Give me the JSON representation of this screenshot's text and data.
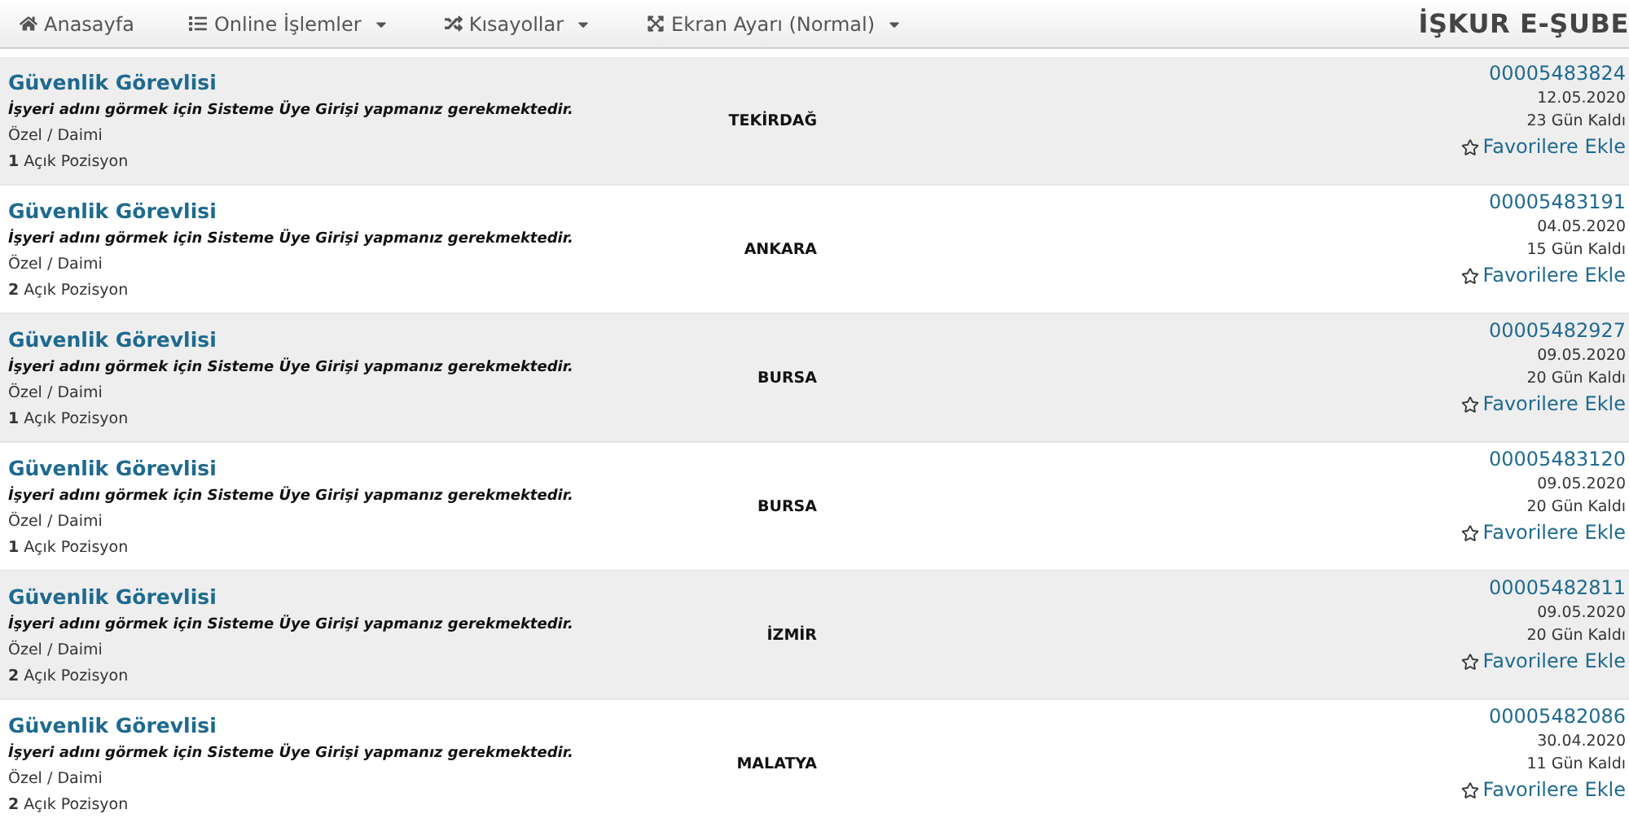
{
  "nav": {
    "items": [
      {
        "kind": "home",
        "label": "Anasayfa",
        "dropdown": false
      },
      {
        "kind": "list",
        "label": "Online İşlemler",
        "dropdown": true
      },
      {
        "kind": "shuffle",
        "label": "Kısayollar",
        "dropdown": true
      },
      {
        "kind": "expand",
        "label": "Ekran Ayarı (Normal)",
        "dropdown": true
      }
    ],
    "brand": "İŞKUR E-ŞUBE"
  },
  "jobs": [
    {
      "title": "Güvenlik Görevlisi",
      "notice": "İşyeri adını görmek için Sisteme Üye Girişi yapmanız gerekmektedir.",
      "type": "Özel / Daimi",
      "count": "1",
      "positions": "Açık Pozisyon",
      "city": "TEKİRDAĞ",
      "number": "00005483824",
      "date": "12.05.2020",
      "remaining": "23 Gün Kaldı",
      "favorite": "Favorilere Ekle"
    },
    {
      "title": "Güvenlik Görevlisi",
      "notice": "İşyeri adını görmek için Sisteme Üye Girişi yapmanız gerekmektedir.",
      "type": "Özel / Daimi",
      "count": "2",
      "positions": "Açık Pozisyon",
      "city": "ANKARA",
      "number": "00005483191",
      "date": "04.05.2020",
      "remaining": "15 Gün Kaldı",
      "favorite": "Favorilere Ekle"
    },
    {
      "title": "Güvenlik Görevlisi",
      "notice": "İşyeri adını görmek için Sisteme Üye Girişi yapmanız gerekmektedir.",
      "type": "Özel / Daimi",
      "count": "1",
      "positions": "Açık Pozisyon",
      "city": "BURSA",
      "number": "00005482927",
      "date": "09.05.2020",
      "remaining": "20 Gün Kaldı",
      "favorite": "Favorilere Ekle"
    },
    {
      "title": "Güvenlik Görevlisi",
      "notice": "İşyeri adını görmek için Sisteme Üye Girişi yapmanız gerekmektedir.",
      "type": "Özel / Daimi",
      "count": "1",
      "positions": "Açık Pozisyon",
      "city": "BURSA",
      "number": "00005483120",
      "date": "09.05.2020",
      "remaining": "20 Gün Kaldı",
      "favorite": "Favorilere Ekle"
    },
    {
      "title": "Güvenlik Görevlisi",
      "notice": "İşyeri adını görmek için Sisteme Üye Girişi yapmanız gerekmektedir.",
      "type": "Özel / Daimi",
      "count": "2",
      "positions": "Açık Pozisyon",
      "city": "İZMİR",
      "number": "00005482811",
      "date": "09.05.2020",
      "remaining": "20 Gün Kaldı",
      "favorite": "Favorilere Ekle"
    },
    {
      "title": "Güvenlik Görevlisi",
      "notice": "İşyeri adını görmek için Sisteme Üye Girişi yapmanız gerekmektedir.",
      "type": "Özel / Daimi",
      "count": "2",
      "positions": "Açık Pozisyon",
      "city": "MALATYA",
      "number": "00005482086",
      "date": "30.04.2020",
      "remaining": "11 Gün Kaldı",
      "favorite": "Favorilere Ekle"
    }
  ]
}
